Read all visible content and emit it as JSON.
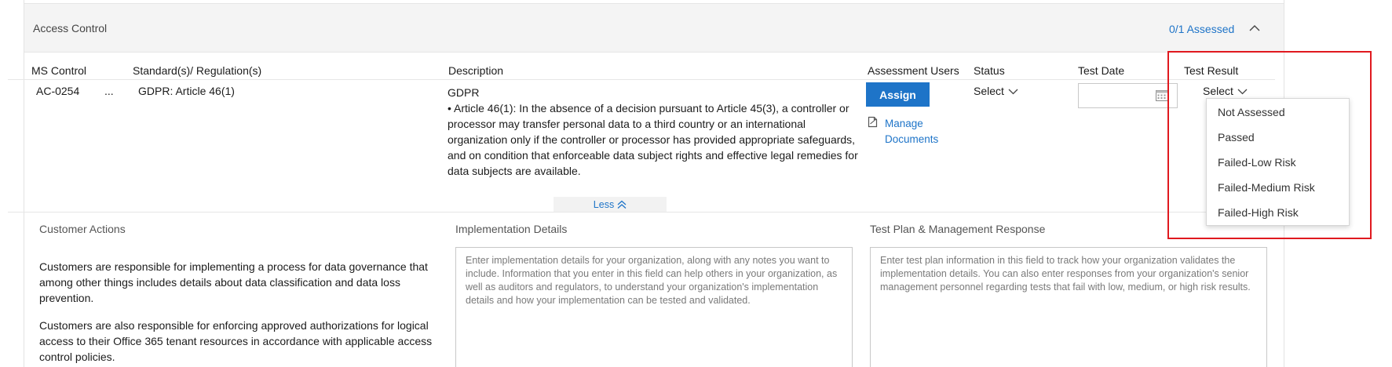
{
  "section": {
    "title": "Access Control",
    "assessed": "0/1 Assessed"
  },
  "columns": {
    "ms_control": "MS Control",
    "standards": "Standard(s)/ Regulation(s)",
    "description": "Description",
    "assessment_users": "Assessment Users",
    "status": "Status",
    "test_date": "Test Date",
    "test_result": "Test Result"
  },
  "row": {
    "control_id": "AC-0254",
    "more": "...",
    "regulation": "GDPR: Article 46(1)",
    "description_title": "GDPR",
    "description_bullet": "•  Article 46(1): In the absence of a decision pursuant to Article 45(3), a controller or processor may transfer personal data to a third country or an international organization only if the controller or processor has provided appropriate safeguards, and on condition that enforceable data subject rights and effective legal remedies for data subjects are available.",
    "assign_label": "Assign",
    "manage_line1": "Manage",
    "manage_line2": "Documents",
    "status_select": "Select",
    "test_date_value": "",
    "test_result_select": "Select"
  },
  "less_label": "Less",
  "details": {
    "customer_actions_label": "Customer Actions",
    "customer_actions_p1": "Customers are responsible for implementing a process for data governance that among other things includes details about data classification and data loss prevention.",
    "customer_actions_p2": "Customers are also responsible for enforcing approved authorizations for logical access to their Office 365 tenant resources in accordance with applicable access control policies.",
    "implementation_label": "Implementation Details",
    "implementation_placeholder": "Enter implementation details for your organization, along with any notes you want to include. Information that you enter in this field can help others in your organization, as well as auditors and regulators, to understand your organization's implementation details and how your implementation can be tested and validated.",
    "test_plan_label": "Test Plan & Management Response",
    "test_plan_placeholder": "Enter test plan information in this field to track how your organization validates the implementation details. You can also enter responses from your organization's senior management personnel regarding tests that fail with low, medium, or high risk results."
  },
  "test_result_options": [
    "Not Assessed",
    "Passed",
    "Failed-Low Risk",
    "Failed-Medium Risk",
    "Failed-High Risk"
  ],
  "colors": {
    "accent": "#1e74c8",
    "highlight": "#e0191f",
    "header_bg": "#f4f4f4"
  },
  "icons": [
    "chevron-up-icon",
    "chevron-down-icon",
    "document-icon",
    "calendar-icon",
    "double-chevron-up-icon"
  ]
}
